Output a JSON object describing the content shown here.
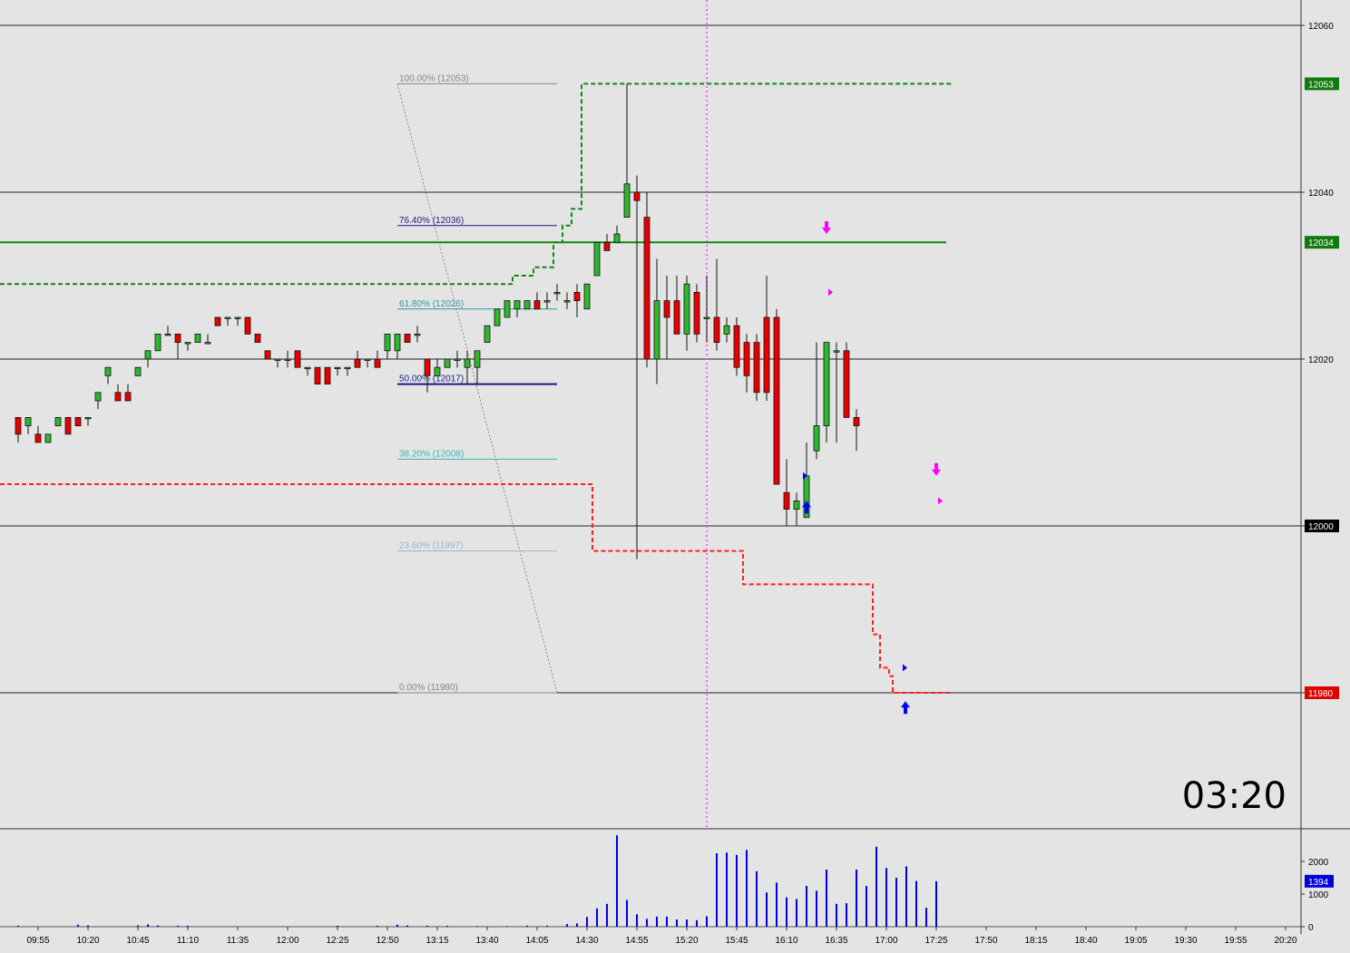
{
  "chart_data": [
    {
      "type": "candlestick",
      "panel": "price",
      "y_ticks": [
        12060,
        12040,
        12020,
        12000,
        11980
      ],
      "ylim": [
        11964,
        12063
      ],
      "x_tick_labels": [
        "09:55",
        "10:20",
        "10:45",
        "11:10",
        "11:35",
        "12:00",
        "12:25",
        "12:50",
        "13:15",
        "13:40",
        "14:05",
        "14:30",
        "14:55",
        "15:20",
        "15:45",
        "16:10",
        "16:35",
        "17:00",
        "17:25",
        "17:50",
        "18:15",
        "18:40",
        "19:05",
        "19:30",
        "19:55",
        "20:20"
      ],
      "bar_interval_minutes": 5,
      "first_bar_time": "09:45",
      "candles": [
        [
          "09:45",
          12013,
          12013,
          12010,
          12011
        ],
        [
          "09:50",
          12012,
          12013,
          12011,
          12013
        ],
        [
          "09:55",
          12011,
          12012,
          12010,
          12010
        ],
        [
          "10:00",
          12010,
          12011,
          12010,
          12011
        ],
        [
          "10:05",
          12012,
          12013,
          12012,
          12013
        ],
        [
          "10:10",
          12013,
          12013,
          12011,
          12011
        ],
        [
          "10:15",
          12013,
          12013,
          12012,
          12012
        ],
        [
          "10:20",
          12013,
          12013,
          12012,
          12013
        ],
        [
          "10:25",
          12015,
          12016,
          12014,
          12016
        ],
        [
          "10:30",
          12018,
          12019,
          12017,
          12019
        ],
        [
          "10:35",
          12016,
          12017,
          12015,
          12015
        ],
        [
          "10:40",
          12016,
          12017,
          12015,
          12015
        ],
        [
          "10:45",
          12018,
          12019,
          12018,
          12019
        ],
        [
          "10:50",
          12020,
          12021,
          12019,
          12021
        ],
        [
          "10:55",
          12021,
          12023,
          12021,
          12023
        ],
        [
          "11:00",
          12023,
          12024,
          12023,
          12023
        ],
        [
          "11:05",
          12023,
          12023,
          12020,
          12022
        ],
        [
          "11:10",
          12022,
          12022,
          12021,
          12022
        ],
        [
          "11:15",
          12022,
          12023,
          12022,
          12023
        ],
        [
          "11:20",
          12022,
          12023,
          12022,
          12022
        ],
        [
          "11:25",
          12025,
          12025,
          12024,
          12024
        ],
        [
          "11:30",
          12025,
          12025,
          12024,
          12025
        ],
        [
          "11:35",
          12025,
          12025,
          12024,
          12025
        ],
        [
          "11:40",
          12025,
          12025,
          12023,
          12023
        ],
        [
          "11:45",
          12023,
          12023,
          12022,
          12022
        ],
        [
          "11:50",
          12021,
          12021,
          12020,
          12020
        ],
        [
          "11:55",
          12020,
          12020,
          12019,
          12020
        ],
        [
          "12:00",
          12020,
          12021,
          12019,
          12020
        ],
        [
          "12:05",
          12021,
          12021,
          12019,
          12019
        ],
        [
          "12:10",
          12019,
          12019,
          12018,
          12019
        ],
        [
          "12:15",
          12019,
          12019,
          12017,
          12017
        ],
        [
          "12:20",
          12019,
          12019,
          12017,
          12017
        ],
        [
          "12:25",
          12019,
          12019,
          12018,
          12019
        ],
        [
          "12:30",
          12019,
          12019,
          12018,
          12019
        ],
        [
          "12:35",
          12020,
          12021,
          12019,
          12019
        ],
        [
          "12:40",
          12020,
          12020,
          12019,
          12020
        ],
        [
          "12:45",
          12020,
          12021,
          12019,
          12019
        ],
        [
          "12:50",
          12021,
          12023,
          12020,
          12023
        ],
        [
          "12:55",
          12021,
          12022,
          12020,
          12023
        ],
        [
          "13:00",
          12023,
          12023,
          12022,
          12022
        ],
        [
          "13:05",
          12023,
          12024,
          12022,
          12023
        ],
        [
          "13:10",
          12020,
          12020,
          12016,
          12018
        ],
        [
          "13:15",
          12018,
          12020,
          12018,
          12019
        ],
        [
          "13:20",
          12019,
          12020,
          12019,
          12020
        ],
        [
          "13:25",
          12020,
          12021,
          12019,
          12020
        ],
        [
          "13:30",
          12019,
          12021,
          12017,
          12020
        ],
        [
          "13:35",
          12019,
          12021,
          12017,
          12021
        ],
        [
          "13:40",
          12022,
          12024,
          12022,
          12024
        ],
        [
          "13:45",
          12024,
          12026,
          12024,
          12026
        ],
        [
          "13:50",
          12025,
          12027,
          12025,
          12027
        ],
        [
          "13:55",
          12026,
          12027,
          12025,
          12027
        ],
        [
          "14:00",
          12026,
          12027,
          12026,
          12027
        ],
        [
          "14:05",
          12027,
          12028,
          12026,
          12026
        ],
        [
          "14:10",
          12027,
          12028,
          12026,
          12027
        ],
        [
          "14:15",
          12028,
          12029,
          12027,
          12028
        ],
        [
          "14:20",
          12027,
          12028,
          12026,
          12027
        ],
        [
          "14:25",
          12028,
          12029,
          12025,
          12027
        ],
        [
          "14:30",
          12026,
          12029,
          12026,
          12029
        ],
        [
          "14:35",
          12030,
          12034,
          12030,
          12034
        ],
        [
          "14:40",
          12034,
          12035,
          12034,
          12033
        ],
        [
          "14:45",
          12034,
          12036,
          12034,
          12035
        ],
        [
          "14:50",
          12037,
          12053,
          12037,
          12041
        ],
        [
          "14:55",
          12040,
          12042,
          11996,
          12039
        ],
        [
          "15:00",
          12037,
          12040,
          12019,
          12020
        ],
        [
          "15:05",
          12020,
          12032,
          12017,
          12027
        ],
        [
          "15:10",
          12027,
          12030,
          12020,
          12025
        ],
        [
          "15:15",
          12027,
          12030,
          12023,
          12023
        ],
        [
          "15:20",
          12023,
          12030,
          12021,
          12029
        ],
        [
          "15:25",
          12028,
          12029,
          12022,
          12023
        ],
        [
          "15:30",
          12025,
          12030,
          12022,
          12025
        ],
        [
          "15:35",
          12025,
          12032,
          12021,
          12022
        ],
        [
          "15:40",
          12023,
          12025,
          12022,
          12024
        ],
        [
          "15:45",
          12024,
          12025,
          12018,
          12019
        ],
        [
          "15:50",
          12022,
          12023,
          12016,
          12018
        ],
        [
          "15:55",
          12022,
          12023,
          12015,
          12016
        ],
        [
          "16:00",
          12025,
          12030,
          12015,
          12016
        ],
        [
          "16:05",
          12025,
          12026,
          12007,
          12005
        ],
        [
          "16:10",
          12004,
          12008,
          12000,
          12002
        ],
        [
          "16:15",
          12002,
          12004,
          12000,
          12003
        ],
        [
          "16:20",
          12001,
          12010,
          12001,
          12006
        ],
        [
          "16:25",
          12009,
          12022,
          12008,
          12012
        ],
        [
          "16:30",
          12012,
          12022,
          12010,
          12022
        ],
        [
          "16:35",
          12021,
          12022,
          12010,
          12021
        ],
        [
          "16:40",
          12021,
          12022,
          12013,
          12013
        ],
        [
          "16:45",
          12013,
          12014,
          12009,
          12012
        ]
      ],
      "levels": [
        {
          "label": "12060",
          "value": 12060
        },
        {
          "label": "12040",
          "value": 12040
        },
        {
          "label": "12020",
          "value": 12020
        },
        {
          "label": "12000",
          "value": 12000
        },
        {
          "label": "11980",
          "value": 11980
        }
      ],
      "price_tags": [
        {
          "text": "12053",
          "value": 12053,
          "color": "#0f7a0f"
        },
        {
          "text": "12034",
          "value": 12034,
          "color": "#0f7a0f"
        },
        {
          "text": "12000",
          "value": 12000,
          "color": "#000000"
        },
        {
          "text": "11980",
          "value": 11980,
          "color": "#e00000"
        }
      ],
      "fibonacci": [
        {
          "label": "100.00% (12053)",
          "value": 12053,
          "color": "#888888"
        },
        {
          "label": "76.40% (12036)",
          "value": 12036,
          "color": "#1a1a8a"
        },
        {
          "label": "61.80% (12026)",
          "value": 12026,
          "color": "#2a9a9a"
        },
        {
          "label": "50.00% (12017)",
          "value": 12017,
          "color": "#1a1a8a"
        },
        {
          "label": "38.20% (12008)",
          "value": 12008,
          "color": "#38b8b8"
        },
        {
          "label": "23.60% (11997)",
          "value": 11997,
          "color": "#9ab4cc"
        },
        {
          "label": "0.00% (11980)",
          "value": 11980,
          "color": "#888888"
        }
      ],
      "colors": {
        "up": "#2fb72f",
        "down": "#e80000",
        "support": "#ff2020",
        "resistance": "#0f8a0f",
        "session": "#ff40ff",
        "signal_up": "#0000ff",
        "signal_down": "#ff00ff"
      }
    },
    {
      "type": "bar",
      "panel": "volume",
      "y_ticks": [
        2000,
        1000,
        0
      ],
      "current_value": "1394",
      "ylim": [
        0,
        2900
      ]
    }
  ],
  "clock": "03:20"
}
